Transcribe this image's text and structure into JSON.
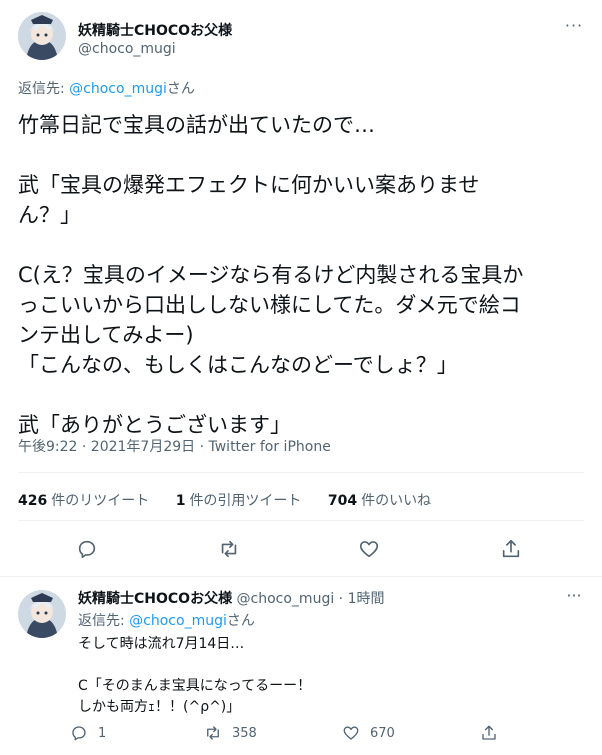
{
  "tweet": {
    "author_name": "妖精騎士CHOCOお父様",
    "author_handle": "@choco_mugi",
    "more_glyph": "···",
    "reply_prefix": "返信先: ",
    "reply_handle": "@choco_mugi",
    "reply_suffix": "さん",
    "body": "竹箒日記で宝具の話が出ていたので…\n\n武「宝具の爆発エフェクトに何かいい案ありませ\nん？」\n\nC(え？宝具のイメージなら有るけど内製される宝具か\nっこいいから口出しし‌ない様にしてた。ダメ元で絵コ\nンテ出してみよー)\n「こんなの、もしくはこんなのどーでしょ？」\n\n武「ありがとうございます」",
    "timestamp": "午後9:22 · 2021年7月29日 · Twitter for iPhone",
    "stats": {
      "retweets_count": "426",
      "retweets_label": "件のリツイート",
      "quotes_count": "1",
      "quotes_label": "件の引用ツイート",
      "likes_count": "704",
      "likes_label": "件のいいね"
    },
    "actions": [
      "reply-icon",
      "retweet-icon",
      "like-icon",
      "share-icon"
    ]
  },
  "reply": {
    "author_name": "妖精騎士CHOCOお父様",
    "author_handle": "@choco_mugi",
    "dot": " · ",
    "time": "1時間",
    "more_glyph": "···",
    "reply_prefix": "返信先: ",
    "reply_handle": "@choco_mugi",
    "reply_suffix": "さん",
    "body": "そして時は流れ7月14日…\n\nC「そのまんま宝具になってるーー！\nしかも両方ｪ！！(^ρ^)」",
    "reply_count": "1",
    "retweet_count": "358",
    "like_count": "670"
  },
  "colors": {
    "text": "#0f1419",
    "secondary": "#536471",
    "link": "#1d9bf0",
    "divider": "#eff3f4"
  }
}
